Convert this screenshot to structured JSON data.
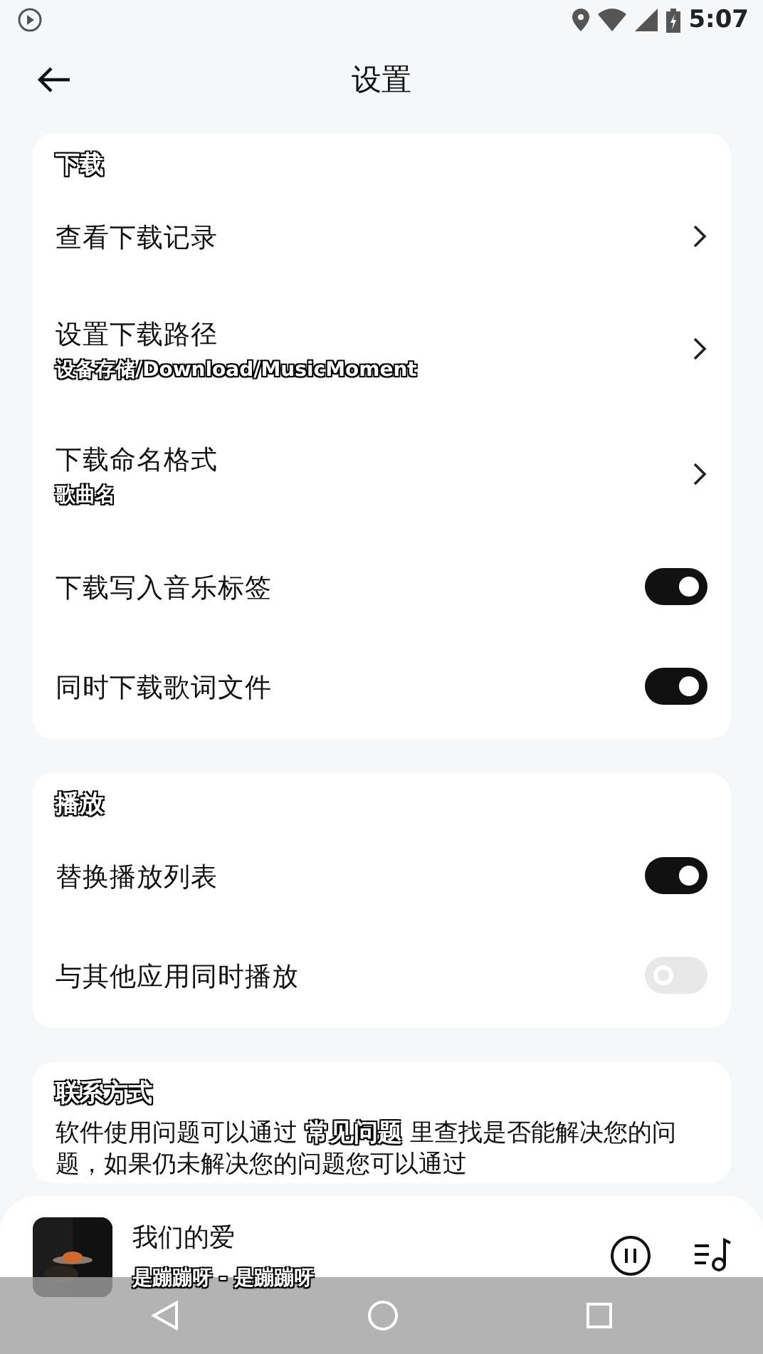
{
  "status_bar": {
    "time": "5:07"
  },
  "header": {
    "title": "设置"
  },
  "sections": [
    {
      "title": "下载",
      "rows": [
        {
          "kind": "link",
          "label": "查看下载记录"
        },
        {
          "kind": "link",
          "label": "设置下载路径",
          "subtitle": "设备存储/Download/MusicMoment"
        },
        {
          "kind": "link",
          "label": "下载命名格式",
          "subtitle": "歌曲名"
        },
        {
          "kind": "toggle",
          "label": "下载写入音乐标签",
          "on": true
        },
        {
          "kind": "toggle",
          "label": "同时下载歌词文件",
          "on": true
        }
      ]
    },
    {
      "title": "播放",
      "rows": [
        {
          "kind": "toggle",
          "label": "替换播放列表",
          "on": true
        },
        {
          "kind": "toggle",
          "label": "与其他应用同时播放",
          "on": false
        }
      ]
    },
    {
      "title": "联系方式",
      "text_before": "软件使用问题可以通过 ",
      "link": "常见问题",
      "text_after": " 里查找是否能解决您的问题，如果仍未解决您的问题您可以通过"
    }
  ],
  "player": {
    "kind": "picture",
    "song": "我们的爱",
    "artist": "是蹦蹦呀 - 是蹦蹦呀",
    "playing": true
  }
}
